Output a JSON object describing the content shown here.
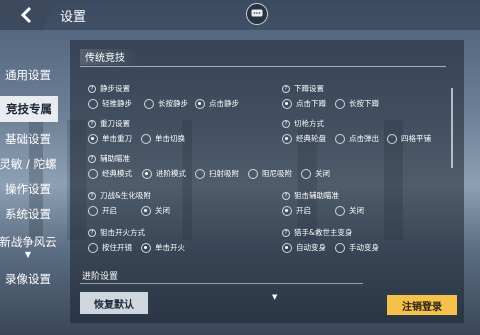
{
  "header": {
    "title": "设置"
  },
  "sidebar": {
    "items": [
      {
        "label": "通用设置"
      },
      {
        "label": "竞技专属"
      },
      {
        "label": "基础设置"
      },
      {
        "label": "灵敏 / 陀螺"
      },
      {
        "label": "操作设置"
      },
      {
        "label": "系统设置"
      },
      {
        "label": "新战争风云"
      },
      {
        "label": "录像设置"
      }
    ],
    "active": "竞技专属"
  },
  "section": {
    "title": "传统竞技"
  },
  "settings": {
    "jingbu": {
      "label": "静步设置",
      "options": [
        "轻推静步",
        "长按静步",
        "点击静步"
      ],
      "selected": "点击静步"
    },
    "xiadun": {
      "label": "下蹲设置",
      "options": [
        "点击下蹲",
        "长按下蹲"
      ],
      "selected": "点击下蹲"
    },
    "zhongdao": {
      "label": "重刀设置",
      "options": [
        "单击重刀",
        "单击切换"
      ],
      "selected": "单击重刀"
    },
    "qieqiang": {
      "label": "切枪方式",
      "options": [
        "经典轮盘",
        "点击弹出",
        "四格平铺"
      ],
      "selected": "经典轮盘"
    },
    "fuzhu": {
      "label": "辅助瞄准",
      "options": [
        "经典模式",
        "进阶模式",
        "扫射吸附",
        "阻尼吸附",
        "关闭"
      ],
      "selected": "进阶模式"
    },
    "daozhan": {
      "label": "刀战&生化吸附",
      "options": [
        "开启",
        "关闭"
      ],
      "selected": "关闭"
    },
    "jujifuzhu": {
      "label": "狙击辅助瞄准",
      "options": [
        "开启",
        "关闭"
      ],
      "selected": "开启"
    },
    "jujikaihuo": {
      "label": "狙击开火方式",
      "options": [
        "按住开镜",
        "单击开火"
      ],
      "selected": "单击开火"
    },
    "liequan": {
      "label": "猎手&救世主变身",
      "options": [
        "自动变身",
        "手动变身"
      ],
      "selected": "自动变身"
    }
  },
  "advanced": {
    "label": "进阶设置"
  },
  "buttons": {
    "restore": "恢复默认",
    "logout": "注销登录"
  },
  "icons": {
    "back": "chevron-left-icon",
    "chat": "chat-bubble-icon"
  },
  "colors": {
    "accent": "#f4c24a",
    "active_tab_bg": "#e8ecf1"
  }
}
